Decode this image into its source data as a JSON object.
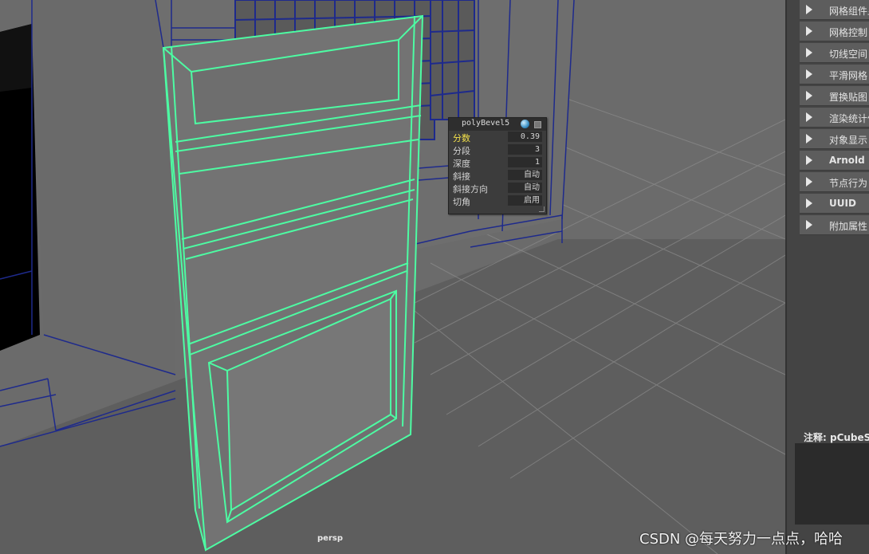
{
  "viewport": {
    "camera_label": "persp"
  },
  "bevel_box": {
    "title": "polyBevel5",
    "rows": [
      {
        "label": "分数",
        "value": "0.39",
        "highlighted": true
      },
      {
        "label": "分段",
        "value": "3"
      },
      {
        "label": "深度",
        "value": "1"
      },
      {
        "label": "斜接",
        "value": "自动"
      },
      {
        "label": "斜接方向",
        "value": "自动"
      },
      {
        "label": "切角",
        "value": "启用"
      }
    ]
  },
  "side_panel": {
    "sections": [
      {
        "label": "网格组件显"
      },
      {
        "label": "网格控制"
      },
      {
        "label": "切线空间"
      },
      {
        "label": "平滑网格"
      },
      {
        "label": "置换贴图"
      },
      {
        "label": "渲染统计信"
      },
      {
        "label": "对象显示"
      },
      {
        "label": "Arnold",
        "bold": true
      },
      {
        "label": "节点行为"
      },
      {
        "label": "UUID",
        "bold": true
      },
      {
        "label": "附加属性"
      }
    ],
    "notes_label": "注释:  pCubeSh"
  },
  "watermark": "CSDN @每天努力一点点，哈哈",
  "colors": {
    "viewport_bg": "#6b6b6b",
    "wire_blue": "#1e2a8c",
    "selection_green": "#4dfca3",
    "highlight_yellow": "#f2e04a"
  }
}
